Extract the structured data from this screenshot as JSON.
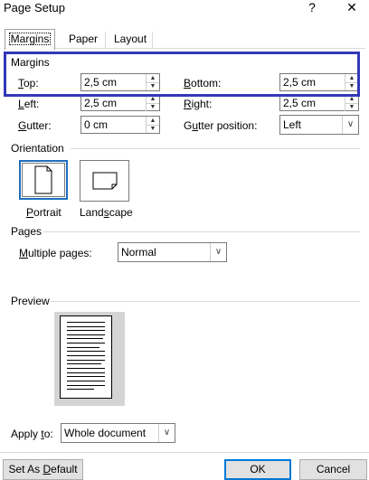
{
  "window": {
    "title": "Page Setup",
    "help_glyph": "?",
    "close_glyph": "✕"
  },
  "tabs": [
    {
      "label": "Margins"
    },
    {
      "label": "Paper"
    },
    {
      "label": "Layout"
    }
  ],
  "margins": {
    "section": "Margins",
    "top": {
      "label_u": "T",
      "label_rest": "op:",
      "value": "2,5 cm"
    },
    "bottom": {
      "label_u": "B",
      "label_rest": "ottom:",
      "value": "2,5 cm"
    },
    "left": {
      "label_u": "L",
      "label_rest": "eft:",
      "value": "2,5 cm"
    },
    "right": {
      "label_u": "R",
      "label_rest": "ight:",
      "value": "2,5 cm"
    },
    "gutter": {
      "label_u": "G",
      "label_rest": "utter:",
      "value": "0 cm"
    },
    "gutter_position": {
      "label_pre": "G",
      "label_u": "u",
      "label_rest": "tter position:",
      "value": "Left"
    }
  },
  "orientation": {
    "section": "Orientation",
    "portrait": {
      "label_u": "P",
      "label_rest": "ortrait"
    },
    "landscape": {
      "label_pre": "Land",
      "label_u": "s",
      "label_rest": "cape"
    }
  },
  "pages": {
    "section": "Pages",
    "multiple": {
      "label_u": "M",
      "label_rest": "ultiple pages:",
      "value": "Normal"
    }
  },
  "preview": {
    "section": "Preview"
  },
  "apply": {
    "label_pre": "Apply ",
    "label_u": "t",
    "label_rest": "o:",
    "value": "Whole document"
  },
  "buttons": {
    "set_default": {
      "label_pre": "Set As ",
      "label_u": "D",
      "label_rest": "efault"
    },
    "ok": "OK",
    "cancel": "Cancel"
  },
  "colors": {
    "highlight": "#3339b6",
    "default_button_border": "#0078d7"
  }
}
